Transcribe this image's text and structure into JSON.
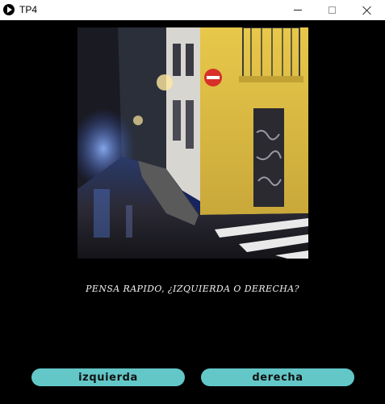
{
  "window": {
    "title": "TP4",
    "icon": "play-circle-icon"
  },
  "scene": {
    "image_description_icon": "street-corner-photo"
  },
  "question": "PENSA RAPIDO, ¿IZQUIERDA O DERECHA?",
  "buttons": {
    "left_label": "izquierda",
    "right_label": "derecha"
  },
  "colors": {
    "background": "#000000",
    "button": "#63c7c8",
    "question_text": "#f2f2f2"
  }
}
